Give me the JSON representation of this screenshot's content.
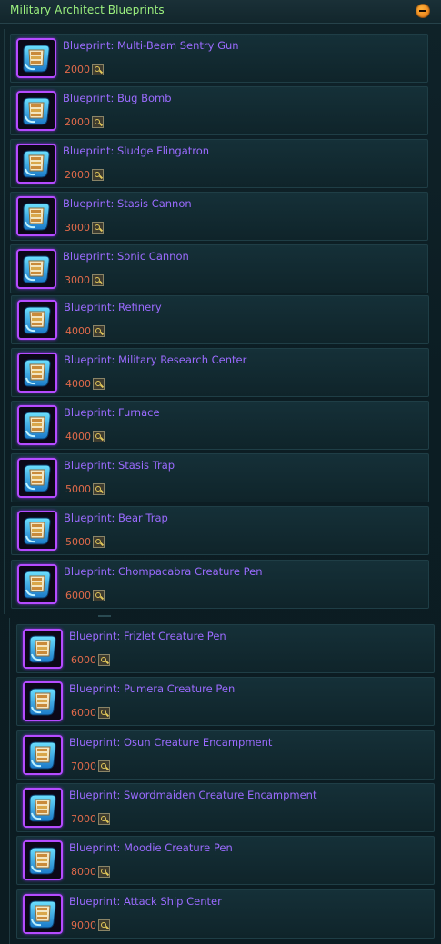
{
  "header": {
    "title": "Military Architect Blueprints",
    "collapse_icon": "minus-circle-icon"
  },
  "currency_icon": "credit-icon",
  "item_icon": "blueprint-scroll-icon",
  "colors": {
    "title": "#9cf07e",
    "item_name": "#9b6bff",
    "price": "#e06a4a",
    "icon_border": "#b54bff",
    "collapse": "#f08a1e"
  },
  "items": [
    {
      "name": "Blueprint: Multi-Beam Sentry Gun",
      "price": "2000"
    },
    {
      "name": "Blueprint: Bug Bomb",
      "price": "2000"
    },
    {
      "name": "Blueprint: Sludge Flingatron",
      "price": "2000"
    },
    {
      "name": "Blueprint: Stasis Cannon",
      "price": "3000"
    },
    {
      "name": "Blueprint: Sonic Cannon",
      "price": "3000"
    },
    {
      "name": "Blueprint: Refinery",
      "price": "4000"
    },
    {
      "name": "Blueprint: Military Research Center",
      "price": "4000"
    },
    {
      "name": "Blueprint: Furnace",
      "price": "4000"
    },
    {
      "name": "Blueprint: Stasis Trap",
      "price": "5000"
    },
    {
      "name": "Blueprint: Bear Trap",
      "price": "5000"
    },
    {
      "name": "Blueprint: Chompacabra Creature Pen",
      "price": "6000"
    },
    {
      "name": "Blueprint: Frizlet Creature Pen",
      "price": "6000"
    },
    {
      "name": "Blueprint: Pumera Creature Pen",
      "price": "6000"
    },
    {
      "name": "Blueprint: Osun Creature Encampment",
      "price": "7000"
    },
    {
      "name": "Blueprint: Swordmaiden Creature Encampment",
      "price": "7000"
    },
    {
      "name": "Blueprint: Moodie Creature Pen",
      "price": "8000"
    },
    {
      "name": "Blueprint: Attack Ship Center",
      "price": "9000"
    }
  ]
}
